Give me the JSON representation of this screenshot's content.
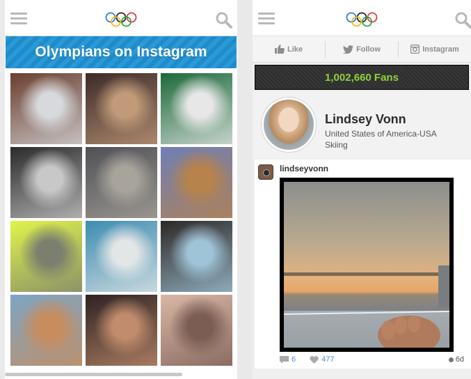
{
  "left": {
    "banner_title": "Olympians on Instagram",
    "tiles": [
      {
        "name": "sneakers-photo",
        "c1": "#6b3f2f",
        "c2": "#d7d9dc"
      },
      {
        "name": "athlete-medal-photo",
        "c1": "#3d2b2a",
        "c2": "#c09a79"
      },
      {
        "name": "jerseys-photo",
        "c1": "#1c6a3a",
        "c2": "#e7e7e7"
      },
      {
        "name": "gym-bags-photo",
        "c1": "#2b2b2b",
        "c2": "#c8c8c8"
      },
      {
        "name": "gym-training-photo",
        "c1": "#505055",
        "c2": "#a8a49c"
      },
      {
        "name": "collage-photo",
        "c1": "#6f7fb5",
        "c2": "#b7824b"
      },
      {
        "name": "helmet-selfie-photo",
        "c1": "#e0f44a",
        "c2": "#7b7f6e"
      },
      {
        "name": "ballet-photo",
        "c1": "#3d8db0",
        "c2": "#e3e6e7"
      },
      {
        "name": "athlete-pose-photo",
        "c1": "#2e2825",
        "c2": "#9fc4d8"
      },
      {
        "name": "wrap-food-photo",
        "c1": "#7ea5c3",
        "c2": "#c78d5f"
      },
      {
        "name": "friends-photo",
        "c1": "#2d2322",
        "c2": "#c18c6d"
      },
      {
        "name": "knee-photo",
        "c1": "#d9b7a6",
        "c2": "#7b5d54"
      }
    ]
  },
  "right": {
    "actions": {
      "like": "Like",
      "follow": "Follow",
      "instagram": "Instagram"
    },
    "fans": "1,002,660 Fans",
    "profile": {
      "name": "Lindsey Vonn",
      "country": "United States of America-USA",
      "sport": "Skiing"
    },
    "post": {
      "username": "lindseyvonn",
      "comments": "6",
      "likes": "477",
      "age": "6d"
    }
  },
  "colors": {
    "banner": "#2a9ad6",
    "fans_text": "#8fd13c",
    "link": "#4c8ed0"
  }
}
